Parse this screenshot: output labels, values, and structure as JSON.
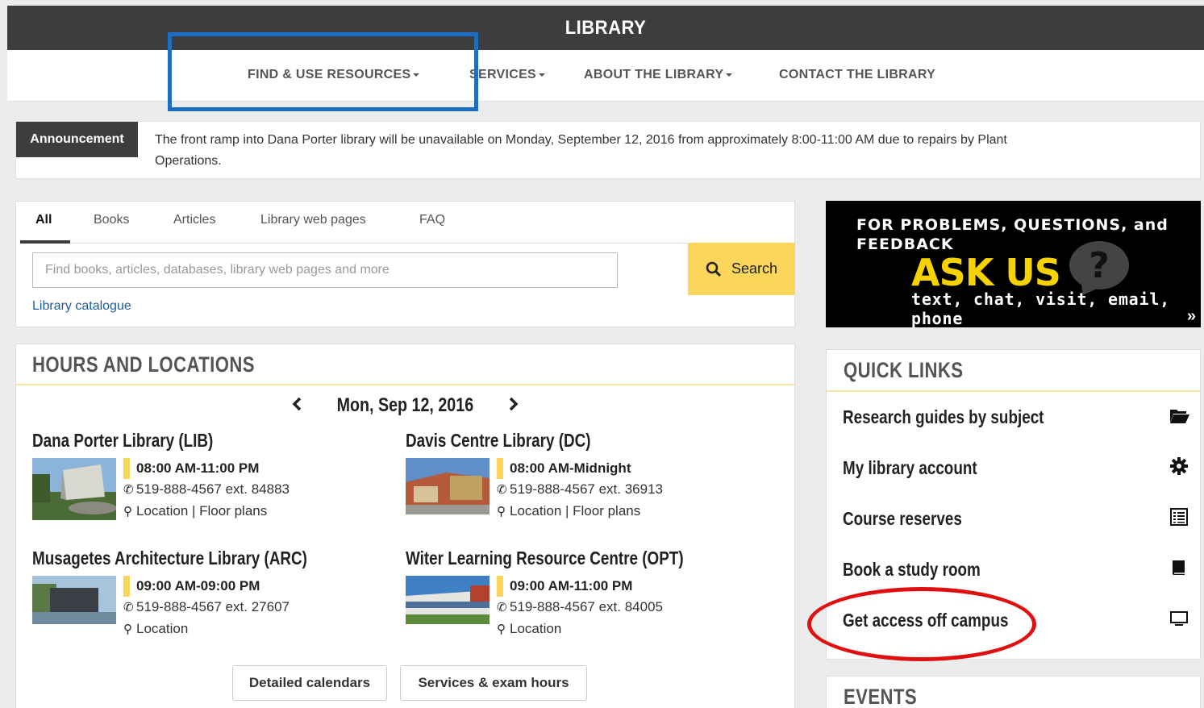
{
  "header": {
    "title": "LIBRARY"
  },
  "nav": {
    "items": [
      {
        "label": "FIND & USE RESOURCES",
        "dropdown": true
      },
      {
        "label": "SERVICES",
        "dropdown": true
      },
      {
        "label": "ABOUT THE LIBRARY",
        "dropdown": true
      },
      {
        "label": "CONTACT THE LIBRARY",
        "dropdown": false
      }
    ]
  },
  "announcement": {
    "tag": "Announcement",
    "message": "The front ramp into Dana Porter library will be unavailable on Monday, September 12, 2016 from approximately 8:00-11:00 AM due to repairs by Plant Operations."
  },
  "search": {
    "tabs": [
      "All",
      "Books",
      "Articles",
      "Library web pages",
      "FAQ"
    ],
    "active_tab": "All",
    "placeholder": "Find books, articles, databases, library web pages and more",
    "button_label": "Search",
    "catalogue_link": "Library catalogue"
  },
  "ask_us": {
    "line1": "FOR PROBLEMS, QUESTIONS, and FEEDBACK",
    "headline": "ASK US",
    "bubble": "?",
    "sub": "text, chat, visit, email, phone",
    "more": "»"
  },
  "hours": {
    "heading": "HOURS AND LOCATIONS",
    "date": "Mon, Sep 12, 2016",
    "prev": "‹",
    "next": "›",
    "locations": [
      {
        "name": "Dana Porter Library (LIB)",
        "hours": "08:00 AM-11:00 PM",
        "phone": "519-888-4567 ext. 84883",
        "links": "Location | Floor plans"
      },
      {
        "name": "Davis Centre Library (DC)",
        "hours": "08:00 AM-Midnight",
        "phone": "519-888-4567 ext. 36913",
        "links": "Location | Floor plans"
      },
      {
        "name": "Musagetes Architecture Library (ARC)",
        "hours": "09:00 AM-09:00 PM",
        "phone": "519-888-4567 ext. 27607",
        "links": "Location"
      },
      {
        "name": "Witer Learning Resource Centre (OPT)",
        "hours": "09:00 AM-11:00 PM",
        "phone": "519-888-4567 ext. 84005",
        "links": "Location"
      }
    ],
    "buttons": [
      "Detailed calendars",
      "Services & exam hours"
    ]
  },
  "quick_links": {
    "heading": "QUICK LINKS",
    "items": [
      {
        "label": "Research guides by subject",
        "icon": "folder-open-icon"
      },
      {
        "label": "My library account",
        "icon": "gear-icon"
      },
      {
        "label": "Course reserves",
        "icon": "list-icon"
      },
      {
        "label": "Book a study room",
        "icon": "book-icon"
      },
      {
        "label": "Get access off campus",
        "icon": "monitor-icon"
      }
    ]
  },
  "events": {
    "heading": "EVENTS"
  },
  "colors": {
    "accent": "#fbd65a",
    "dark": "#3d3d3d",
    "annotation_blue": "#1a6fc4",
    "annotation_red": "#e01010"
  }
}
